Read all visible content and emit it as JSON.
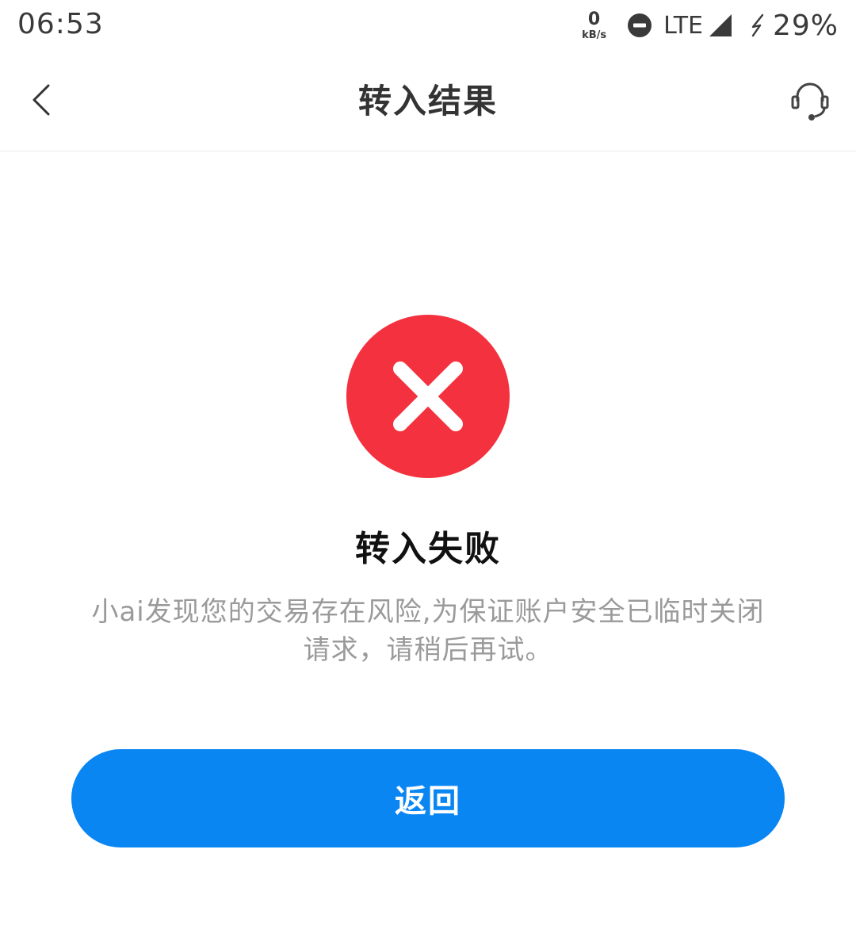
{
  "status_bar": {
    "time": "06:53",
    "net_speed_value": "0",
    "net_speed_unit": "kB/s",
    "network": "LTE",
    "battery": "29%",
    "icons": [
      "dnd-icon",
      "signal-icon",
      "charging-icon"
    ]
  },
  "nav": {
    "title": "转入结果",
    "back_icon": "chevron-left-icon",
    "service_icon": "headset-icon"
  },
  "result": {
    "status": "failure",
    "icon": "error-x-icon",
    "icon_color": "#f4323f",
    "title": "转入失败",
    "description": "小ai发现您的交易存在风险,为保证账户安全已临时关闭请求，请稍后再试。"
  },
  "actions": {
    "return_label": "返回",
    "button_color": "#0a86f3"
  }
}
